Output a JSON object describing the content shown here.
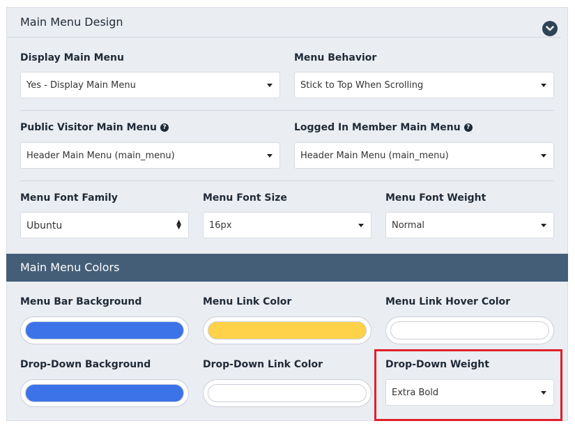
{
  "section": {
    "title": "Main Menu Design"
  },
  "fields": {
    "display_main_menu": {
      "label": "Display Main Menu",
      "value": "Yes - Display Main Menu"
    },
    "menu_behavior": {
      "label": "Menu Behavior",
      "value": "Stick to Top When Scrolling"
    },
    "public_visitor_menu": {
      "label": "Public Visitor Main Menu",
      "value": "Header Main Menu (main_menu)"
    },
    "logged_in_menu": {
      "label": "Logged In Member Main Menu",
      "value": "Header Main Menu (main_menu)"
    },
    "font_family": {
      "label": "Menu Font Family",
      "value": "Ubuntu"
    },
    "font_size": {
      "label": "Menu Font Size",
      "value": "16px"
    },
    "font_weight": {
      "label": "Menu Font Weight",
      "value": "Normal"
    }
  },
  "colors_section": {
    "title": "Main Menu Colors"
  },
  "colors": {
    "menu_bar_background": {
      "label": "Menu Bar Background",
      "color": "#3d73e8"
    },
    "menu_link_color": {
      "label": "Menu Link Color",
      "color": "#ffd24a"
    },
    "menu_link_hover_color": {
      "label": "Menu Link Hover Color",
      "color": "#ffffff"
    },
    "dropdown_background": {
      "label": "Drop-Down Background",
      "color": "#3d73e8"
    },
    "dropdown_link_color": {
      "label": "Drop-Down Link Color",
      "color": "#ffffff"
    }
  },
  "dropdown_weight": {
    "label": "Drop-Down Weight",
    "value": "Extra Bold"
  },
  "theme": {
    "panel_bg": "#eaedf2",
    "header_bar": "#445e78",
    "highlight": "#e0202a"
  }
}
